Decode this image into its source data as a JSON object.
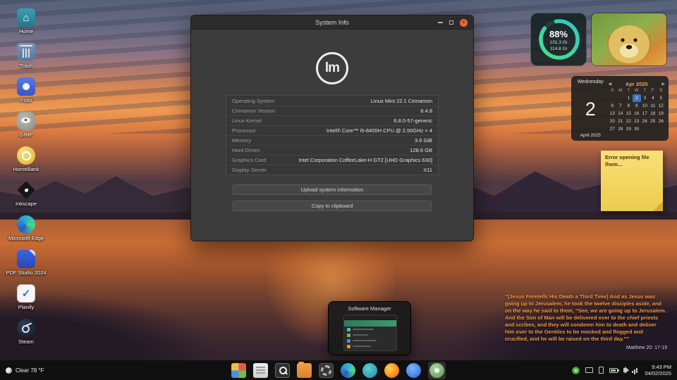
{
  "desktop_icons": [
    {
      "label": "Home"
    },
    {
      "label": "Trash"
    },
    {
      "label": "Folio"
    },
    {
      "label": "GIMP"
    },
    {
      "label": "HomeBank"
    },
    {
      "label": "Inkscape"
    },
    {
      "label": "Microsoft Edge"
    },
    {
      "label": "PDF Studio 2024"
    },
    {
      "label": "Planify"
    },
    {
      "label": "Steam"
    }
  ],
  "icons": {
    "home_glyph": "⌂",
    "check_glyph": "✓",
    "close_glyph": "×"
  },
  "window": {
    "title": "System Info",
    "logo_text": "lm",
    "rows": [
      {
        "label": "Operating System",
        "value": "Linux Mint 22.1 Cinnamon"
      },
      {
        "label": "Cinnamon Version",
        "value": "6.4.8"
      },
      {
        "label": "Linux Kernel",
        "value": "6.8.0-57-generic"
      },
      {
        "label": "Processor",
        "value": "Intel® Core™ i5-8400H CPU @ 2.50GHz × 4"
      },
      {
        "label": "Memory",
        "value": "3.6 GiB"
      },
      {
        "label": "Hard Drives",
        "value": "128.6 GB"
      },
      {
        "label": "Graphics Card",
        "value": "Intel Corporation CoffeeLake-H GT2 [UHD Graphics 630]"
      },
      {
        "label": "Display Server",
        "value": "X11"
      }
    ],
    "upload_button": "Upload system information",
    "copy_button": "Copy to clipboard"
  },
  "widgets": {
    "disk": {
      "percent": "88%",
      "used": "101.3 Gi",
      "total": "114.8 Gi"
    },
    "calendar": {
      "weekday": "Wednesday",
      "day": "2",
      "month_year": "April 2025",
      "header": "Apr 2025",
      "prev": "◀",
      "next": "▶",
      "day_headers": [
        "S",
        "M",
        "T",
        "W",
        "T",
        "F",
        "S"
      ],
      "weeks": [
        [
          "",
          "",
          "1",
          "2",
          "3",
          "4",
          "5"
        ],
        [
          "6",
          "7",
          "8",
          "9",
          "10",
          "11",
          "12"
        ],
        [
          "13",
          "14",
          "15",
          "16",
          "17",
          "18",
          "19"
        ],
        [
          "20",
          "21",
          "22",
          "23",
          "24",
          "25",
          "26"
        ],
        [
          "27",
          "28",
          "29",
          "30",
          "",
          "",
          ""
        ]
      ]
    },
    "note": {
      "text": "Error opening file /hom..."
    },
    "verse": {
      "text": "“[Jesus Foretells His Death a Third Time]  And as Jesus was going up to Jerusalem, he took the twelve disciples aside, and on the way he said to them, “See, we are going up to Jerusalem. And the Son of Man will be delivered over to the chief priests and scribes, and they will condemn him to death and deliver him over to the Gentiles to be mocked and flogged and crucified, and he will be raised on the third day.””",
      "reference": "Matthew 20: 17-19"
    }
  },
  "preview": {
    "title": "Software Manager"
  },
  "taskbar": {
    "weather": "Clear 78 °F",
    "time": "9:43 PM",
    "date": "04/02/2025"
  }
}
